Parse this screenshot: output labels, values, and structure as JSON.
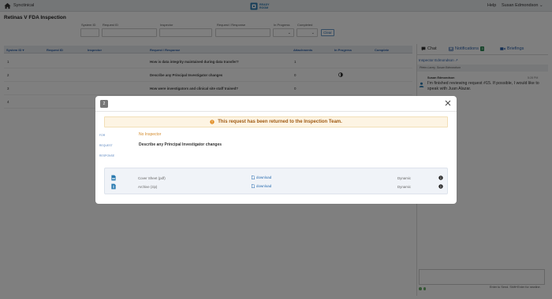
{
  "topbar": {
    "app_name": "Synctinical",
    "logo_line1": "READY",
    "logo_line2": "ROOM",
    "help_label": "Help",
    "user_name": "Susan Edmondson"
  },
  "page": {
    "title": "Retinas V FDA Inspection"
  },
  "filters": {
    "system_id_label": "System ID",
    "request_id_label": "Request ID",
    "inspector_label": "Inspector",
    "request_response_label": "Request / Response",
    "in_progress_label": "In Progress",
    "completed_label": "Completed",
    "clear_label": "Clear"
  },
  "table": {
    "headers": [
      "System ID",
      "Request ID",
      "Inspector",
      "Request / Response",
      "Attachments",
      "In Progress",
      "Complete"
    ],
    "rows": [
      {
        "system_id": "1",
        "question": "How is data integrity maintained during data transfer?",
        "attachments": "1"
      },
      {
        "system_id": "2",
        "question": "Describe any Principal Investigator changes",
        "attachments": "0"
      },
      {
        "system_id": "3",
        "question": "How were investigators and clinical site staff trained?",
        "attachments": "0"
      },
      {
        "system_id": "4",
        "question": "",
        "attachments": ""
      }
    ]
  },
  "right_panel": {
    "tabs": {
      "chat": "Chat",
      "notifications": "Notifications",
      "notifications_count": "3",
      "briefings": "Briefings"
    },
    "context_title": "Inspector Edmondson",
    "participants": "Pietro Lacey, Susan Edmondson",
    "message": {
      "author": "Susan Edmondson",
      "time": "5:28 PM",
      "text": "I'm finished reviewing request #15. If possible, I would like to speak with Juan Alazar."
    },
    "hint": "Enter to Send. Shift+Enter for newline."
  },
  "modal": {
    "number": "2",
    "alert_text": "This request has been returned to the Inspection Team.",
    "for_label": "FOR",
    "for_value": "No Inspector",
    "request_label": "REQUEST",
    "request_value": "Describe any Principal Investigator changes",
    "response_label": "RESPONSE",
    "files": [
      {
        "name": "Cover Sheet (pdf)",
        "download": "download",
        "type": "Dynamic"
      },
      {
        "name": "Archive (zip)",
        "download": "download",
        "type": "Dynamic"
      }
    ]
  },
  "colors": {
    "accent": "#2a6db0",
    "warning": "#a05a12",
    "success": "#2e8b57"
  }
}
